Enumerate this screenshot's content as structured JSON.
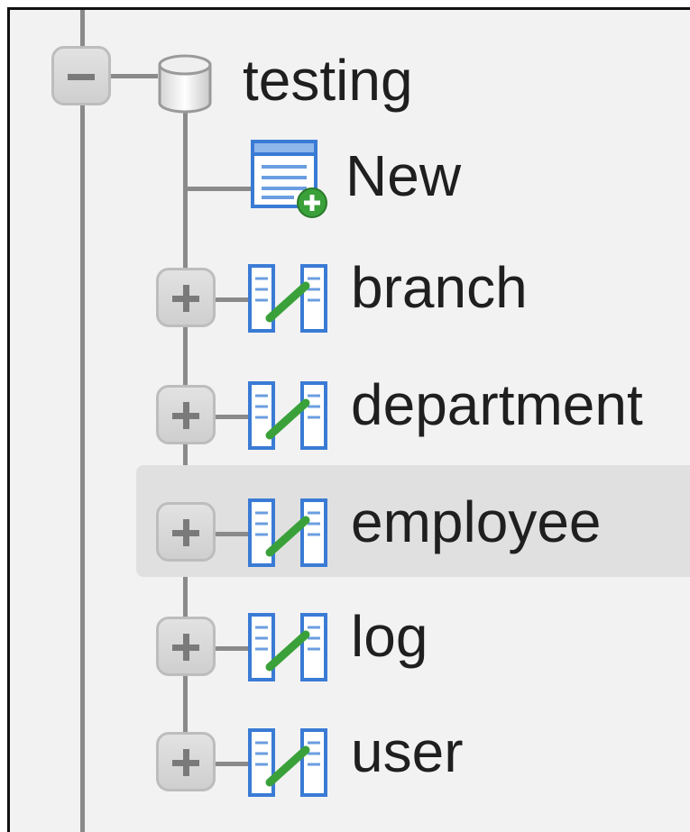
{
  "tree": {
    "database": {
      "name": "testing",
      "expanded": true,
      "icon": "database-icon"
    },
    "new_item": {
      "label": "New",
      "icon": "new-table-icon"
    },
    "tables": [
      {
        "name": "branch",
        "icon": "table-icon",
        "expanded": false
      },
      {
        "name": "department",
        "icon": "table-icon",
        "expanded": false
      },
      {
        "name": "employee",
        "icon": "table-icon",
        "expanded": false,
        "highlighted": true
      },
      {
        "name": "log",
        "icon": "table-icon",
        "expanded": false
      },
      {
        "name": "user",
        "icon": "table-icon",
        "expanded": false
      }
    ]
  },
  "colors": {
    "panel_background": "#f2f2f2",
    "highlight": "#e0e0e0",
    "tree_line": "#8a8a8a",
    "icon_blue": "#3a7bd5",
    "icon_green": "#3aa13a"
  }
}
